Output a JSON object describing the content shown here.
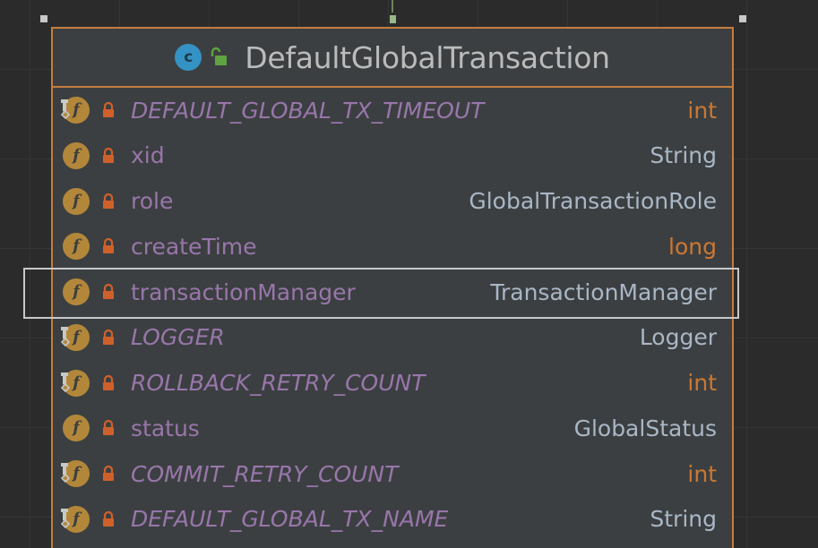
{
  "node": {
    "class_icon_letter": "c",
    "title": "DefaultGlobalTransaction",
    "fields": [
      {
        "name": "DEFAULT_GLOBAL_TX_TIMEOUT",
        "type": "int",
        "static": true,
        "primitive": true
      },
      {
        "name": "xid",
        "type": "String",
        "static": false,
        "primitive": false
      },
      {
        "name": "role",
        "type": "GlobalTransactionRole",
        "static": false,
        "primitive": false
      },
      {
        "name": "createTime",
        "type": "long",
        "static": false,
        "primitive": true
      },
      {
        "name": "transactionManager",
        "type": "TransactionManager",
        "static": false,
        "primitive": false
      },
      {
        "name": "LOGGER",
        "type": "Logger",
        "static": true,
        "primitive": false
      },
      {
        "name": "ROLLBACK_RETRY_COUNT",
        "type": "int",
        "static": true,
        "primitive": true
      },
      {
        "name": "status",
        "type": "GlobalStatus",
        "static": false,
        "primitive": false
      },
      {
        "name": "COMMIT_RETRY_COUNT",
        "type": "int",
        "static": true,
        "primitive": true
      },
      {
        "name": "DEFAULT_GLOBAL_TX_NAME",
        "type": "String",
        "static": true,
        "primitive": false
      }
    ],
    "field_badge_letter": "f"
  },
  "selected_field_index": 4,
  "colors": {
    "background": "#2b2b2b",
    "node_fill": "#3c3f41",
    "node_border": "#c57d3e",
    "field_name": "#9876aa",
    "type_reference": "#a9b7c6",
    "type_primitive": "#cc7832",
    "field_badge": "#b3873a",
    "lock": "#d0602a",
    "class_icon": "#3592c4",
    "unlock": "#5fa342"
  },
  "icons": {
    "class": "class-icon",
    "visibility": "unlock-icon",
    "field": "field-icon",
    "private": "lock-icon",
    "static": "static-pin-icon"
  }
}
